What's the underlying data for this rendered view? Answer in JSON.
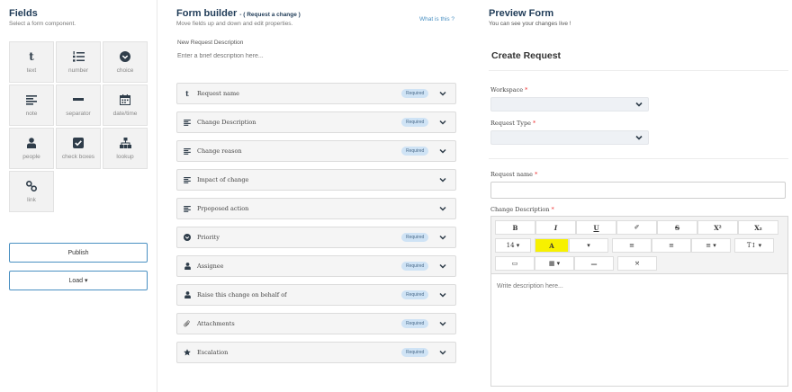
{
  "fields_panel": {
    "title": "Fields",
    "subtitle": "Select a form component.",
    "tiles": [
      {
        "label": "text",
        "icon": "text-icon"
      },
      {
        "label": "number",
        "icon": "list-ol-icon"
      },
      {
        "label": "choice",
        "icon": "chevron-circle-icon"
      },
      {
        "label": "note",
        "icon": "align-left-icon"
      },
      {
        "label": "separator",
        "icon": "minus-icon"
      },
      {
        "label": "date/time",
        "icon": "calendar-icon"
      },
      {
        "label": "people",
        "icon": "user-icon"
      },
      {
        "label": "check boxes",
        "icon": "check-square-icon"
      },
      {
        "label": "lookup",
        "icon": "sitemap-icon"
      },
      {
        "label": "link",
        "icon": "link-icon"
      }
    ],
    "publish_label": "Publish",
    "load_label": "Load ▾"
  },
  "builder": {
    "title": "Form builder",
    "title_suffix": "- ( Request a change )",
    "subtitle": "Move fields up and down and edit properties.",
    "what_is_this": "What is this ?",
    "description_label": "New Request Description",
    "description_placeholder": "Enter a brief description here...",
    "required_label": "Required",
    "rows": [
      {
        "name": "Request name",
        "icon": "text-icon",
        "required": true
      },
      {
        "name": "Change Description",
        "icon": "align-left-icon",
        "required": true
      },
      {
        "name": "Change reason",
        "icon": "align-left-icon",
        "required": true
      },
      {
        "name": "Impact of change",
        "icon": "align-left-icon",
        "required": false
      },
      {
        "name": "Prpoposed action",
        "icon": "align-left-icon",
        "required": false
      },
      {
        "name": "Priority",
        "icon": "chevron-circle-icon",
        "required": true
      },
      {
        "name": "Assignee",
        "icon": "user-icon",
        "required": true
      },
      {
        "name": "Raise this change on behalf of",
        "icon": "user-icon",
        "required": true
      },
      {
        "name": "Attachments",
        "icon": "paperclip-icon",
        "required": true
      },
      {
        "name": "Escalation",
        "icon": "star-icon",
        "required": true
      }
    ]
  },
  "preview": {
    "title": "Preview Form",
    "subtitle": "You can see your changes live !",
    "form_title": "Create Request",
    "workspace_label": "Workspace",
    "request_type_label": "Request Type",
    "request_name_label": "Request name",
    "change_description_label": "Change Description",
    "required_star": "*",
    "toolbar": {
      "bold": "B",
      "italic": "I",
      "underline": "U",
      "eraser": "✐",
      "strike": "S",
      "superscript": "X²",
      "subscript": "X₂",
      "font_size": "14 ▾",
      "highlight": "A",
      "color": "▾",
      "ul": "≡",
      "ol": "≡",
      "align": "≡ ▾",
      "height": "T↕ ▾",
      "picture": "▭",
      "table": "▦ ▾",
      "hr": "—",
      "fullscreen": "⤧"
    },
    "editor_placeholder": "Write description here..."
  }
}
